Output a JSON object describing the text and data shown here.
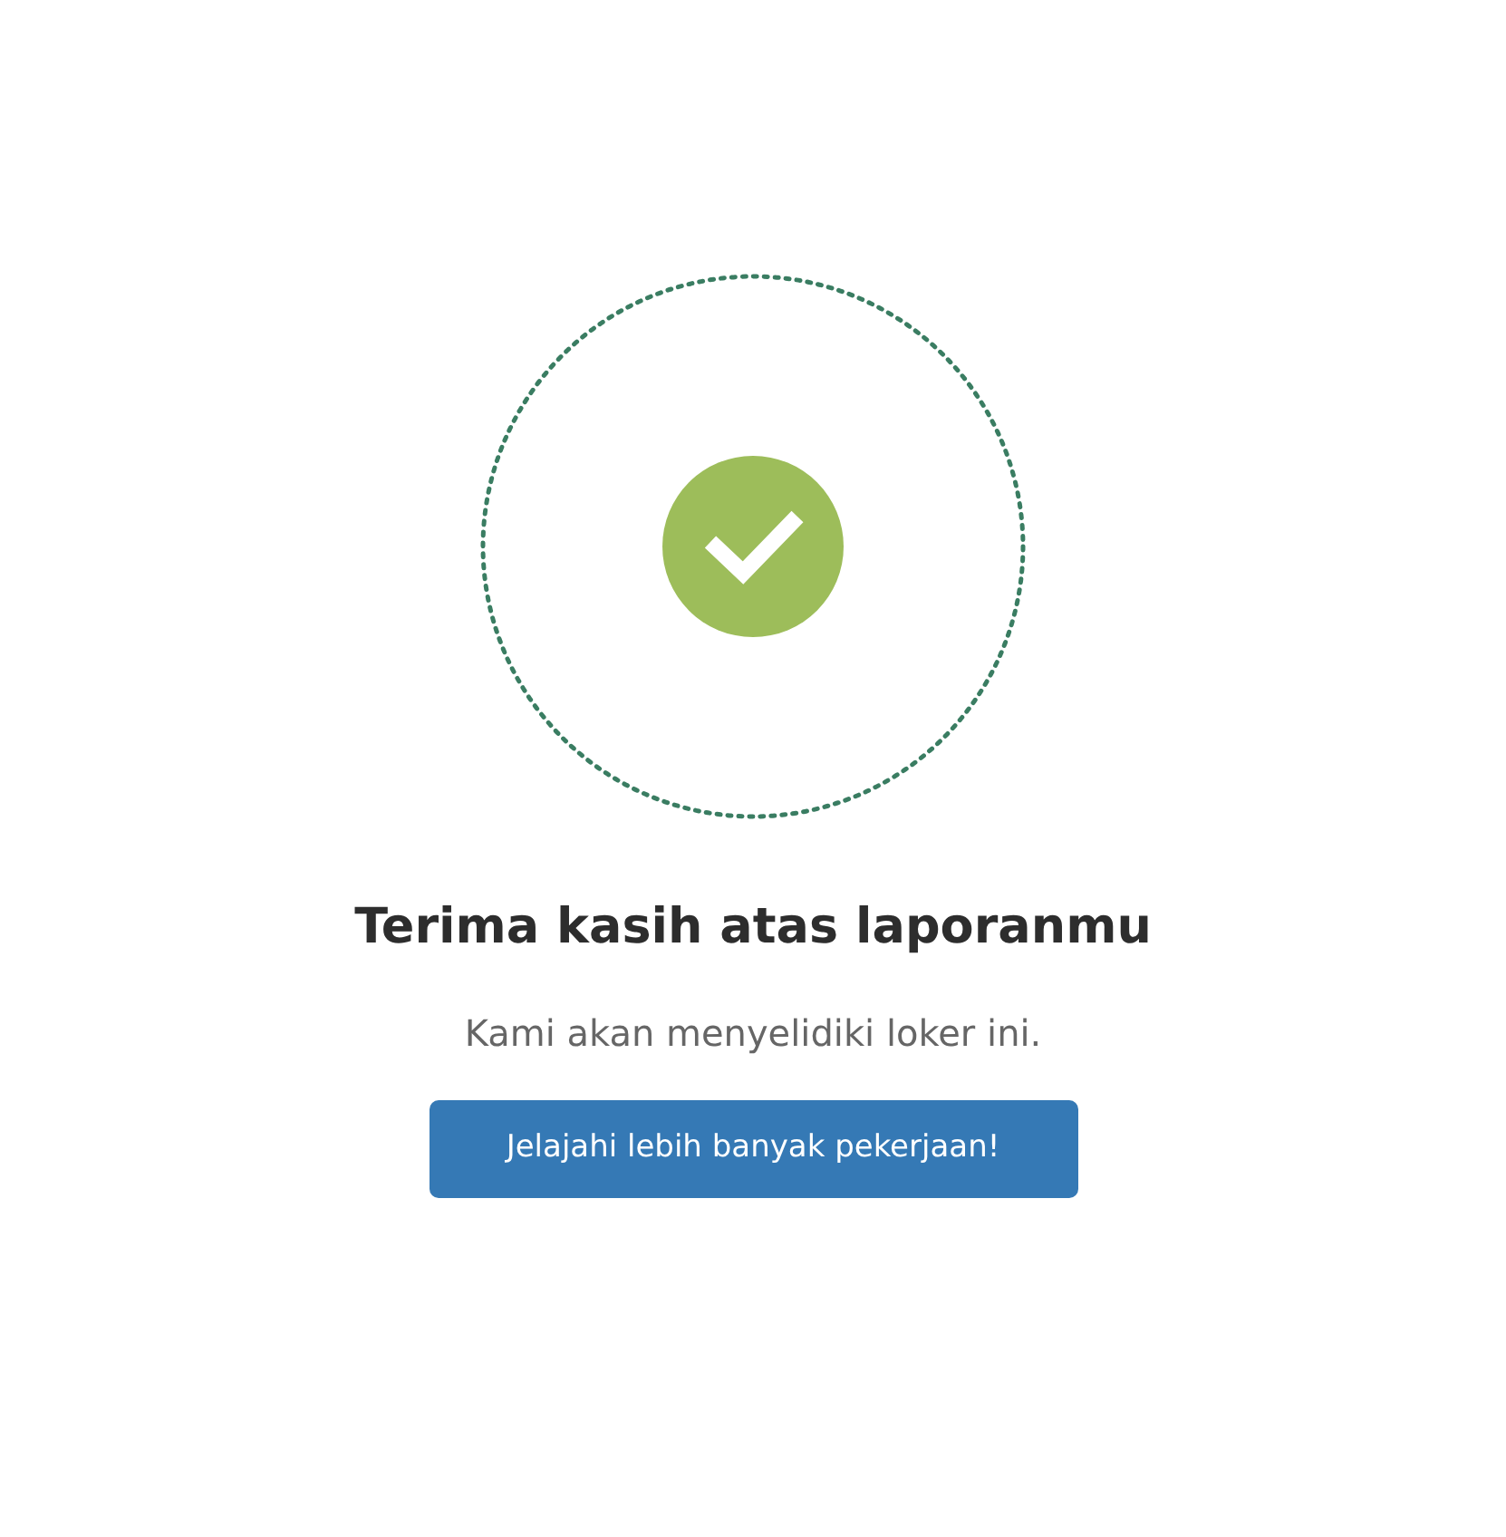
{
  "title": "Terima kasih atas laporanmu",
  "message": "Kami akan menyelidiki loker ini.",
  "button": {
    "label": "Jelajahi lebih banyak pekerjaan!"
  }
}
